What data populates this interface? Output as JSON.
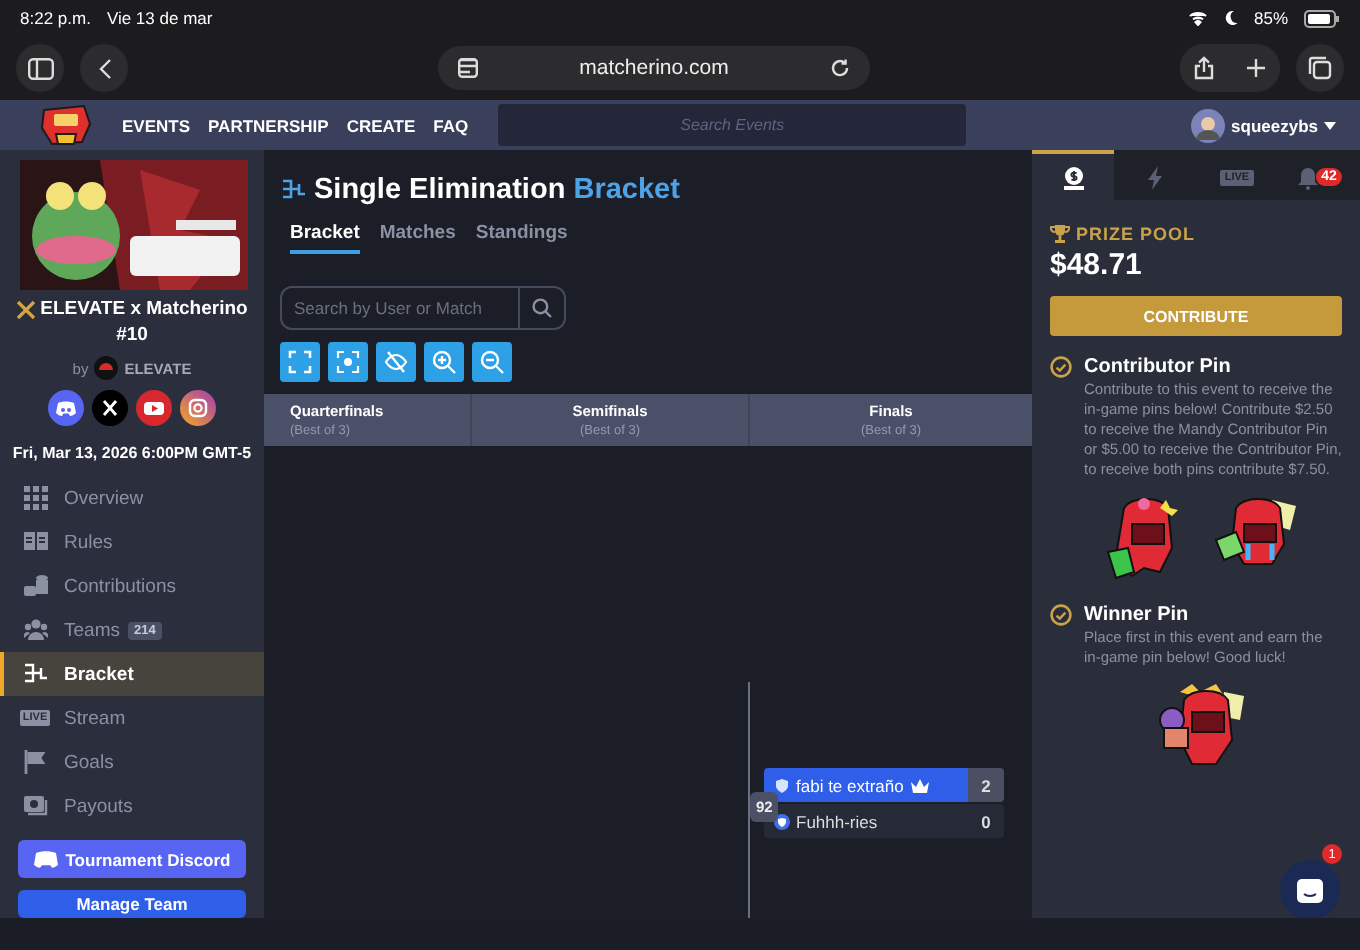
{
  "status_bar": {
    "time": "8:22 p.m.",
    "date": "Vie 13 de mar",
    "battery": "85%"
  },
  "browser": {
    "url": "matcherino.com"
  },
  "nav": {
    "links": [
      "EVENTS",
      "PARTNERSHIP",
      "CREATE",
      "FAQ"
    ],
    "search": {
      "placeholder": "Search Events"
    },
    "user": "squeezybs"
  },
  "event": {
    "title": "ELEVATE x Matcherino #10",
    "by": "by",
    "organizer": "ELEVATE",
    "socials": [
      {
        "kind": "discord"
      },
      {
        "kind": "x"
      },
      {
        "kind": "youtube"
      },
      {
        "kind": "instagram"
      }
    ],
    "date": "Fri, Mar 13, 2026 6:00PM GMT-5"
  },
  "sidebar": {
    "items": [
      {
        "kind": "grid",
        "label": "Overview",
        "selected": false
      },
      {
        "kind": "rules",
        "label": "Rules",
        "selected": false
      },
      {
        "kind": "coins",
        "label": "Contributions",
        "selected": false
      },
      {
        "kind": "people",
        "label": "Teams",
        "badge": "214",
        "selected": false
      },
      {
        "kind": "bracket",
        "label": "Bracket",
        "selected": true
      },
      {
        "kind": "live",
        "icon_text": "LIVE",
        "label": "Stream",
        "selected": false
      },
      {
        "kind": "flag",
        "label": "Goals",
        "selected": false
      },
      {
        "kind": "payout",
        "label": "Payouts",
        "selected": false
      }
    ],
    "buttons": [
      {
        "kind": "discord",
        "label": "Tournament Discord"
      },
      {
        "kind": "primary",
        "label": "Manage Team"
      }
    ]
  },
  "bracket": {
    "title": "Single Elimination",
    "title_accent": "Bracket",
    "tabs": [
      {
        "label": "Bracket",
        "selected": true
      },
      {
        "label": "Matches",
        "selected": false
      },
      {
        "label": "Standings",
        "selected": false
      }
    ],
    "search": {
      "placeholder": "Search by User or Match"
    },
    "tools": [
      {
        "kind": "fit"
      },
      {
        "kind": "focus"
      },
      {
        "kind": "hide"
      },
      {
        "kind": "zoom-in"
      },
      {
        "kind": "zoom-out"
      }
    ],
    "rounds": [
      {
        "name": "Quarterfinals",
        "format": "(Best of 3)"
      },
      {
        "name": "Semifinals",
        "format": "(Best of 3)"
      },
      {
        "name": "Finals",
        "format": "(Best of 3)"
      }
    ],
    "match": {
      "number": "92",
      "teams": [
        {
          "name": "fabi te extraño",
          "score": "2",
          "winner": true
        },
        {
          "name": "Fuhhh-ries",
          "score": "0",
          "winner": false
        }
      ]
    }
  },
  "panel": {
    "tabs": [
      {
        "kind": "prize",
        "selected": true
      },
      {
        "kind": "bolt",
        "selected": false
      },
      {
        "kind": "live",
        "label": "LIVE",
        "selected": false
      },
      {
        "kind": "bell",
        "badge": "42",
        "selected": false
      }
    ],
    "prize_label": "PRIZE POOL",
    "amount": "$48.71",
    "button": "CONTRIBUTE",
    "sections": [
      {
        "title": "Contributor Pin",
        "text": "Contribute to this event to receive the in-game pins below! Contribute $2.50 to receive the Mandy Contributor Pin or $5.00 to receive the Contributor Pin, to receive both pins contribute $7.50."
      },
      {
        "title": "Winner Pin",
        "text": "Place first in this event and earn the in-game pin below! Good luck!"
      }
    ]
  },
  "chat": {
    "badge": "1"
  }
}
